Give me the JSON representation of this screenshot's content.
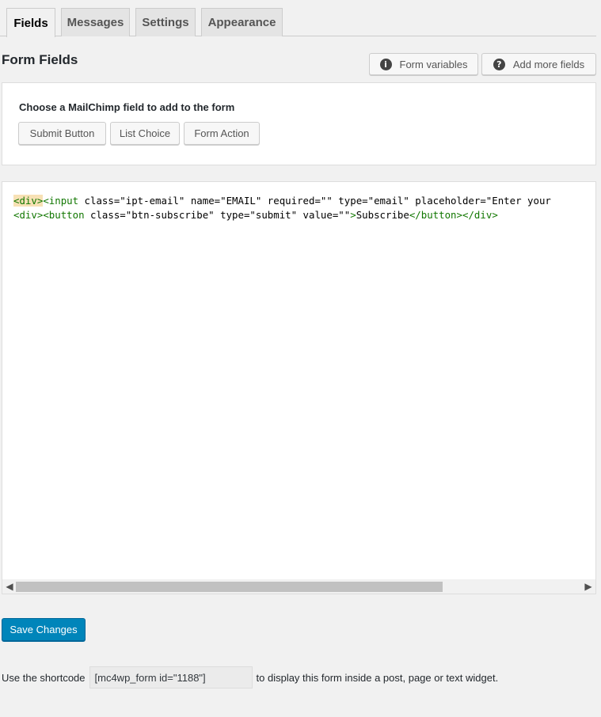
{
  "tabs": [
    {
      "label": "Fields",
      "active": true
    },
    {
      "label": "Messages",
      "active": false
    },
    {
      "label": "Settings",
      "active": false
    },
    {
      "label": "Appearance",
      "active": false
    }
  ],
  "header": {
    "title": "Form Fields",
    "form_variables_label": "Form variables",
    "form_variables_icon": "info-icon",
    "add_more_fields_label": "Add more fields",
    "add_more_fields_icon": "help-icon"
  },
  "chooser": {
    "title": "Choose a MailChimp field to add to the form",
    "buttons": [
      "Submit Button",
      "List Choice",
      "Form Action"
    ]
  },
  "editor": {
    "lines": [
      "<div><input class=\"ipt-email\" name=\"EMAIL\" required=\"\" type=\"email\" placeholder=\"Enter your",
      "<div><button class=\"btn-subscribe\" type=\"submit\" value=\"\">Subscribe</button></div>"
    ],
    "scroll_left_icon": "chevron-left-icon",
    "scroll_right_icon": "chevron-right-icon"
  },
  "save_button": "Save Changes",
  "shortcode": {
    "prefix": "Use the shortcode",
    "value": "[mc4wp_form id=\"1188\"]",
    "suffix": "to display this form inside a post, page or text widget."
  },
  "colors": {
    "primary": "#0085ba",
    "tag": "#117700",
    "attribute": "#0000cc",
    "string": "#aa1111",
    "bracket_highlight": "#f7e1b5"
  }
}
